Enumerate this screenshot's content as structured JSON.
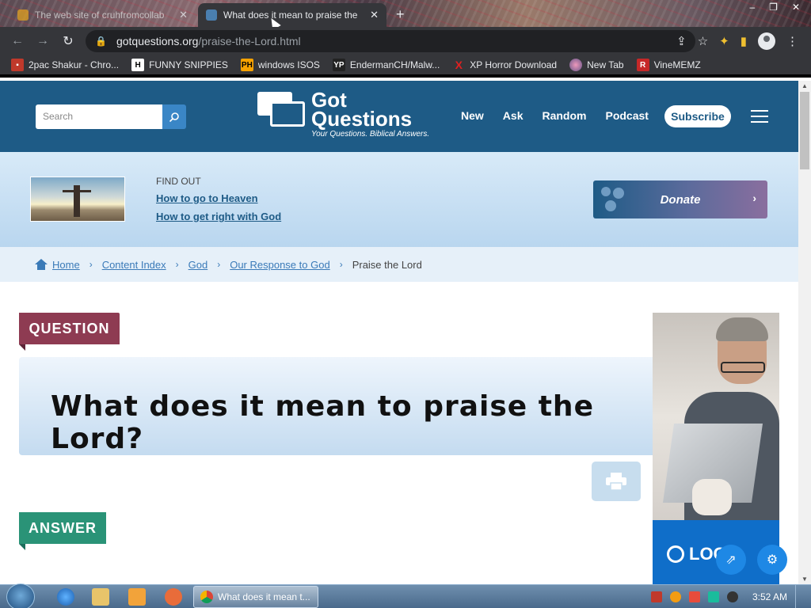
{
  "browser": {
    "tabs": [
      {
        "title": "The web site of cruhfromcollab",
        "active": false
      },
      {
        "title": "What does it mean to praise the",
        "active": true
      }
    ],
    "url_host": "gotquestions.org",
    "url_path": "/praise-the-Lord.html",
    "bookmarks": [
      {
        "label": "2pac Shakur - Chro...",
        "icon": "red-square-icon"
      },
      {
        "label": "FUNNY SNIPPIES",
        "icon": "h-icon"
      },
      {
        "label": "windows ISOS",
        "icon": "ph-icon"
      },
      {
        "label": "EndermanCH/Malw...",
        "icon": "yp-icon"
      },
      {
        "label": "XP Horror Download",
        "icon": "x-icon"
      },
      {
        "label": "New Tab",
        "icon": "globe-icon"
      },
      {
        "label": "VineMEMZ",
        "icon": "r-icon"
      }
    ]
  },
  "site": {
    "search_placeholder": "Search",
    "logo_line1": "Got",
    "logo_line2": "Questions",
    "logo_tagline": "Your Questions. Biblical Answers.",
    "nav": [
      "New",
      "Ask",
      "Random",
      "Podcast"
    ],
    "subscribe": "Subscribe",
    "findout": {
      "label": "FIND OUT",
      "link1": "How to go to Heaven",
      "link2": "How to get right with God"
    },
    "donate": "Donate",
    "breadcrumbs": [
      "Home",
      "Content Index",
      "God",
      "Our Response to God"
    ],
    "breadcrumb_current": "Praise the Lord",
    "question_badge": "QUESTION",
    "question_title": "What does it mean to praise the Lord?",
    "answer_badge": "ANSWER",
    "ad_logo": "LOG"
  },
  "taskbar": {
    "task_title": "What does it mean t...",
    "time": "3:52 AM"
  },
  "colors": {
    "site_blue": "#1e5b86",
    "question_badge": "#8e3b52",
    "answer_badge": "#2a9377"
  }
}
